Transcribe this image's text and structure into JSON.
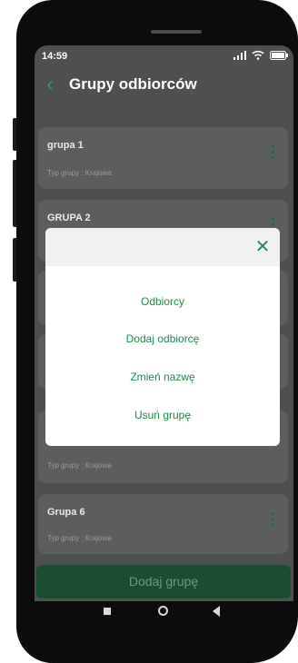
{
  "status": {
    "time": "14:59"
  },
  "header": {
    "title": "Grupy odbiorców"
  },
  "groups": [
    {
      "name": "grupa 1",
      "type": "Typ grupy : Krajowa"
    },
    {
      "name": "GRUPA 2",
      "type": ""
    },
    {
      "name": "",
      "type": "Typ grupy : Krajowa"
    },
    {
      "name": "Grupa 6",
      "type": "Typ grupy : Krajowa"
    }
  ],
  "footer": {
    "add_group_label": "Dodaj grupę"
  },
  "modal": {
    "options": [
      "Odbiorcy",
      "Dodaj odbiorcę",
      "Zmień nazwę",
      "Usuń grupę"
    ]
  },
  "colors": {
    "accent": "#1f8a4c",
    "button": "#1b4e30",
    "overlay": "#4e4f50"
  },
  "icons": [
    "back-arrow-icon",
    "kebab-menu-icon",
    "close-icon",
    "signal-icon",
    "wifi-icon",
    "battery-icon"
  ]
}
